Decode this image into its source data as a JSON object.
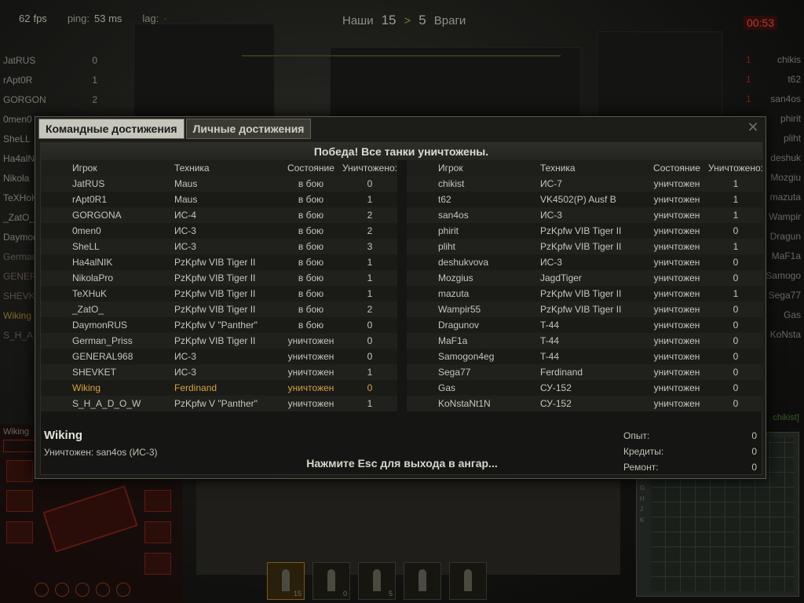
{
  "hud": {
    "fps_value": "62",
    "fps_label": "fps",
    "ping_label": "ping:",
    "ping_value": "53 ms",
    "lag_label": "lag:",
    "team_ours_label": "Наши",
    "score_ours": "15",
    "score_arrow": ">",
    "score_enemy": "5",
    "team_enemy_label": "Враги",
    "timer": "00:53"
  },
  "left_list": [
    {
      "name": "JatRUS",
      "num": "0"
    },
    {
      "name": "rApt0R",
      "num": "1"
    },
    {
      "name": "GORGON",
      "num": "2"
    },
    {
      "name": "0men0",
      "num": ""
    },
    {
      "name": "SheLL",
      "num": ""
    },
    {
      "name": "Ha4alN",
      "num": ""
    },
    {
      "name": "Nikola",
      "num": ""
    },
    {
      "name": "TeXHoK",
      "num": ""
    },
    {
      "name": "_ZatO_",
      "num": ""
    },
    {
      "name": "Daymon",
      "num": ""
    },
    {
      "name": "German",
      "num": ""
    },
    {
      "name": "GENERA",
      "num": ""
    },
    {
      "name": "SHEVKE",
      "num": ""
    },
    {
      "name": "Wiking",
      "num": ""
    },
    {
      "name": "S_H_A_",
      "num": ""
    }
  ],
  "right_list": [
    {
      "name": "chikis",
      "num": "1"
    },
    {
      "name": "t62",
      "num": "1"
    },
    {
      "name": "san4os",
      "num": "1"
    },
    {
      "name": "phirit",
      "num": ""
    },
    {
      "name": "pliht",
      "num": ""
    },
    {
      "name": "deshuk",
      "num": ""
    },
    {
      "name": "Mozgiu",
      "num": ""
    },
    {
      "name": "mazuta",
      "num": ""
    },
    {
      "name": "Wampir",
      "num": ""
    },
    {
      "name": "Dragun",
      "num": ""
    },
    {
      "name": "MaF1a",
      "num": ""
    },
    {
      "name": "Samogo",
      "num": ""
    },
    {
      "name": "Sega77",
      "num": ""
    },
    {
      "name": "Gas",
      "num": ""
    },
    {
      "name": "KoNsta",
      "num": ""
    }
  ],
  "chat_name": "Wiking",
  "right_tag": "chikist]",
  "minimap_letters": [
    "C",
    "D",
    "E",
    "F",
    "G",
    "H",
    "J",
    "K"
  ],
  "bottom_slots": [
    {
      "count": "15"
    },
    {
      "count": "0"
    },
    {
      "count": "5"
    },
    {
      "count": ""
    },
    {
      "count": ""
    }
  ],
  "dialog": {
    "tab_team": "Командные достижения",
    "tab_personal": "Личные достижения",
    "close": "✕",
    "banner": "Победа! Все танки уничтожены.",
    "headers": {
      "player": "Игрок",
      "vehicle": "Техника",
      "status": "Состояние",
      "kills": "Уничтожено:"
    },
    "team_left": [
      {
        "player": "JatRUS",
        "vehicle": "Maus",
        "status": "в бою",
        "kills": "0"
      },
      {
        "player": "rApt0R1",
        "vehicle": "Maus",
        "status": "в бою",
        "kills": "1"
      },
      {
        "player": "GORGONA",
        "vehicle": "ИС-4",
        "status": "в бою",
        "kills": "2"
      },
      {
        "player": "0men0",
        "vehicle": "ИС-3",
        "status": "в бою",
        "kills": "2"
      },
      {
        "player": "SheLL",
        "vehicle": "ИС-3",
        "status": "в бою",
        "kills": "3"
      },
      {
        "player": "Ha4alNIK",
        "vehicle": "PzKpfw VIB Tiger II",
        "status": "в бою",
        "kills": "1"
      },
      {
        "player": "NikolaPro",
        "vehicle": "PzKpfw VIB Tiger II",
        "status": "в бою",
        "kills": "1"
      },
      {
        "player": "TeXHuK",
        "vehicle": "PzKpfw VIB Tiger II",
        "status": "в бою",
        "kills": "1"
      },
      {
        "player": "_ZatO_",
        "vehicle": "PzKpfw VIB Tiger II",
        "status": "в бою",
        "kills": "2"
      },
      {
        "player": "DaymonRUS",
        "vehicle": "PzKpfw V \"Panther\"",
        "status": "в бою",
        "kills": "0"
      },
      {
        "player": "German_Priss",
        "vehicle": "PzKpfw VIB Tiger II",
        "status": "уничтожен",
        "kills": "0"
      },
      {
        "player": "GENERAL968",
        "vehicle": "ИС-3",
        "status": "уничтожен",
        "kills": "0"
      },
      {
        "player": "SHEVKET",
        "vehicle": "ИС-3",
        "status": "уничтожен",
        "kills": "1"
      },
      {
        "player": "Wiking",
        "vehicle": "Ferdinand",
        "status": "уничтожен",
        "kills": "0",
        "me": true
      },
      {
        "player": "S_H_A_D_O_W",
        "vehicle": "PzKpfw V \"Panther\"",
        "status": "уничтожен",
        "kills": "1"
      }
    ],
    "team_right": [
      {
        "player": "chikist",
        "vehicle": "ИС-7",
        "status": "уничтожен",
        "kills": "1"
      },
      {
        "player": "t62",
        "vehicle": "VK4502(P) Ausf B",
        "status": "уничтожен",
        "kills": "1"
      },
      {
        "player": "san4os",
        "vehicle": "ИС-3",
        "status": "уничтожен",
        "kills": "1"
      },
      {
        "player": "phirit",
        "vehicle": "PzKpfw VIB Tiger II",
        "status": "уничтожен",
        "kills": "0"
      },
      {
        "player": "pliht",
        "vehicle": "PzKpfw VIB Tiger II",
        "status": "уничтожен",
        "kills": "1"
      },
      {
        "player": "deshukvova",
        "vehicle": "ИС-3",
        "status": "уничтожен",
        "kills": "0"
      },
      {
        "player": "Mozgius",
        "vehicle": "JagdTiger",
        "status": "уничтожен",
        "kills": "0"
      },
      {
        "player": "mazuta",
        "vehicle": "PzKpfw VIB Tiger II",
        "status": "уничтожен",
        "kills": "1"
      },
      {
        "player": "Wampir55",
        "vehicle": "PzKpfw VIB Tiger II",
        "status": "уничтожен",
        "kills": "0"
      },
      {
        "player": "Dragunov",
        "vehicle": "T-44",
        "status": "уничтожен",
        "kills": "0"
      },
      {
        "player": "MaF1a",
        "vehicle": "T-44",
        "status": "уничтожен",
        "kills": "0"
      },
      {
        "player": "Samogon4eg",
        "vehicle": "T-44",
        "status": "уничтожен",
        "kills": "0"
      },
      {
        "player": "Sega77",
        "vehicle": "Ferdinand",
        "status": "уничтожен",
        "kills": "0"
      },
      {
        "player": "Gas",
        "vehicle": "СУ-152",
        "status": "уничтожен",
        "kills": "0"
      },
      {
        "player": "KoNstaNt1N",
        "vehicle": "СУ-152",
        "status": "уничтожен",
        "kills": "0"
      }
    ],
    "player_name": "Wiking",
    "killed_by": "Уничтожен: san4os (ИС-3)",
    "esc_hint": "Нажмите Esc для выхода в ангар...",
    "stats": [
      {
        "label": "Опыт:",
        "value": "0"
      },
      {
        "label": "Кредиты:",
        "value": "0"
      },
      {
        "label": "Ремонт:",
        "value": "0"
      }
    ]
  }
}
